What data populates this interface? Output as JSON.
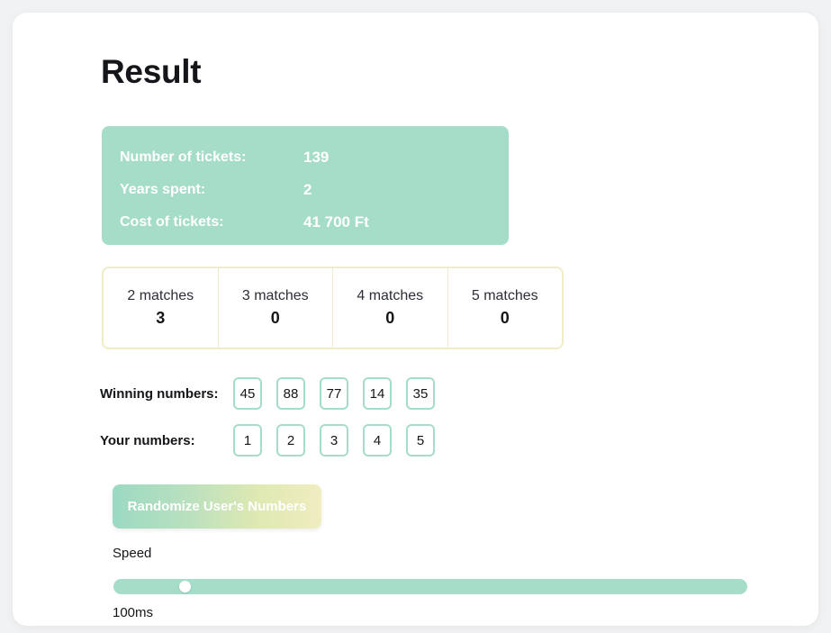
{
  "page": {
    "title": "Result"
  },
  "stats": {
    "rows": [
      {
        "label": "Number of tickets:",
        "value": "139"
      },
      {
        "label": "Years spent:",
        "value": "2"
      },
      {
        "label": "Cost of tickets:",
        "value": "41 700 Ft"
      }
    ]
  },
  "matches": {
    "cells": [
      {
        "label": "2 matches",
        "count": "3"
      },
      {
        "label": "3 matches",
        "count": "0"
      },
      {
        "label": "4 matches",
        "count": "0"
      },
      {
        "label": "5 matches",
        "count": "0"
      }
    ]
  },
  "numbers": {
    "winning": {
      "label": "Winning numbers:",
      "values": [
        "45",
        "88",
        "77",
        "14",
        "35"
      ]
    },
    "user": {
      "label": "Your numbers:",
      "values": [
        "1",
        "2",
        "3",
        "4",
        "5"
      ]
    }
  },
  "actions": {
    "randomize_label": "Randomize User's Numbers"
  },
  "speed": {
    "label": "Speed",
    "value_text": "100ms",
    "thumb_percent": 10.6
  },
  "colors": {
    "mint": "#a5ddc8",
    "cream_border": "#f0ecc8",
    "page_bg": "#f1f2f4",
    "card_bg": "#ffffff",
    "text": "#14161a"
  }
}
